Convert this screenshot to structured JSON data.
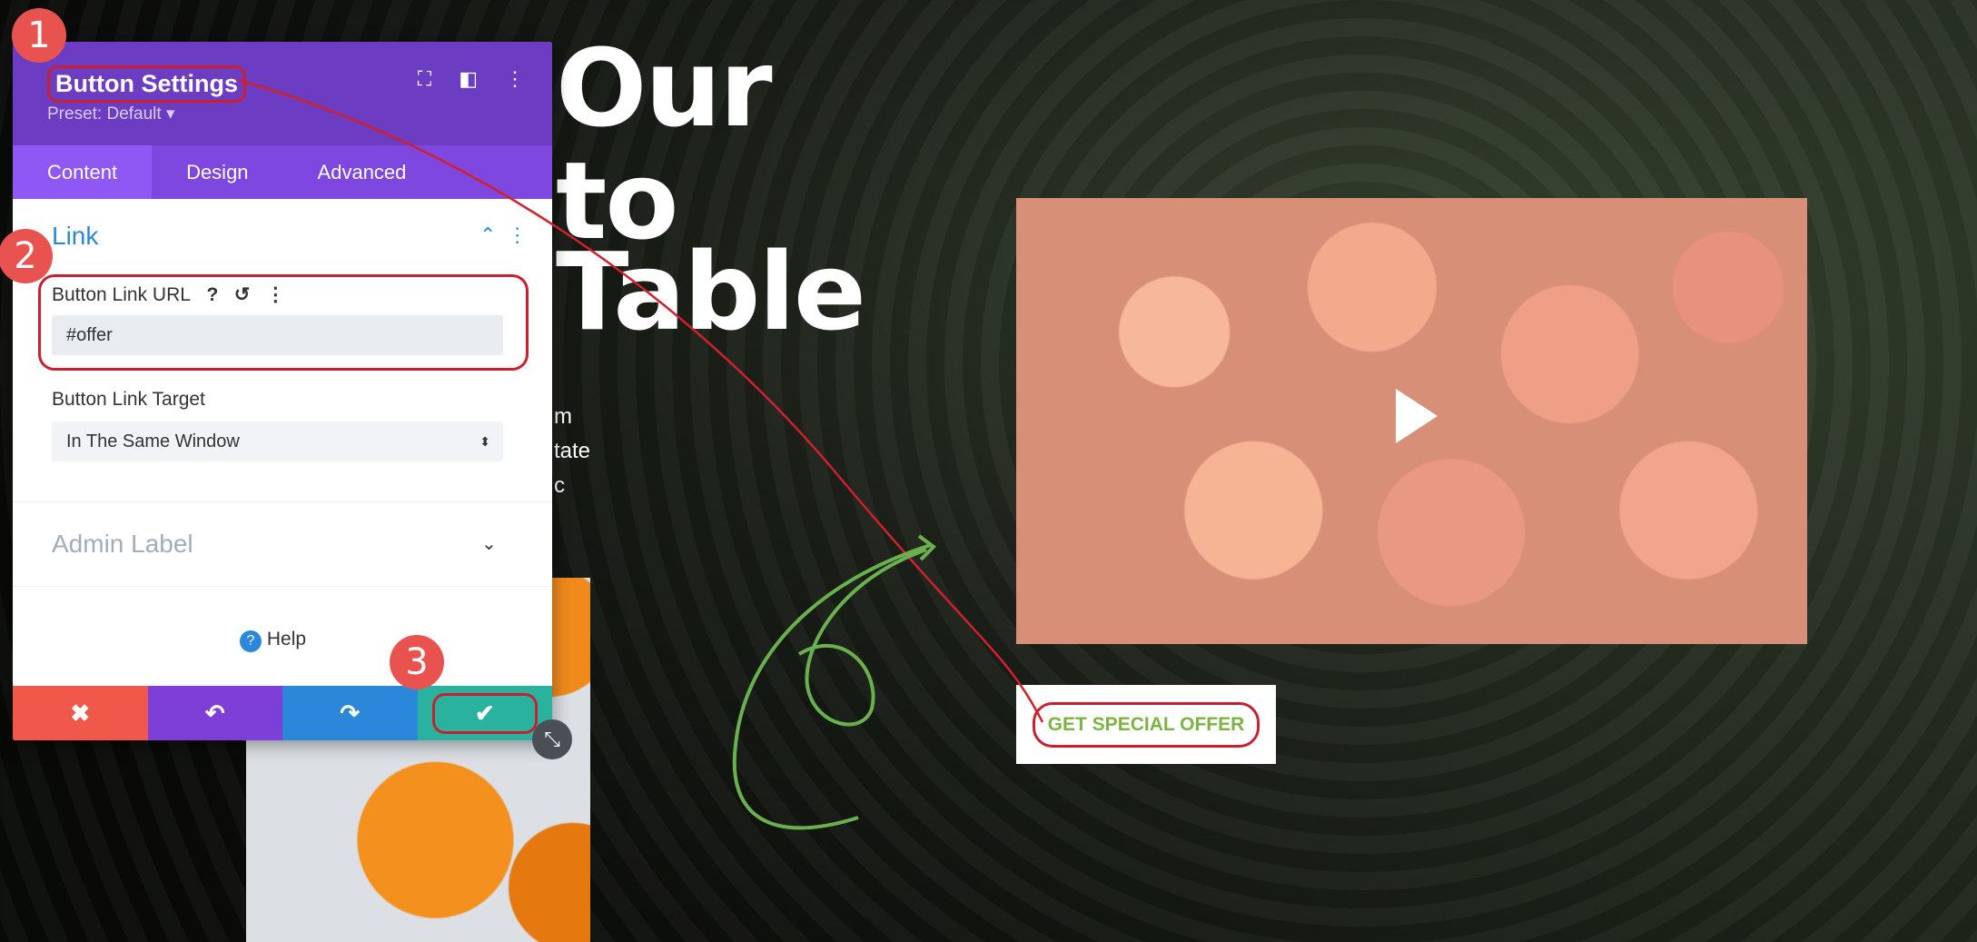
{
  "page": {
    "hero_lines": [
      "Our",
      "to",
      "Table"
    ],
    "partial_text": [
      "m",
      "tate",
      "c"
    ],
    "cta_label": "GET SPECIAL OFFER"
  },
  "panel": {
    "title": "Button Settings",
    "preset": "Preset: Default ▾",
    "header_icons": [
      "focus-icon",
      "split-view-icon",
      "more-icon"
    ],
    "tabs": [
      {
        "label": "Content",
        "active": true
      },
      {
        "label": "Design",
        "active": false
      },
      {
        "label": "Advanced",
        "active": false
      }
    ],
    "section_title": "Link",
    "url_label": "Button Link URL",
    "url_value": "#offer",
    "target_label": "Button Link Target",
    "target_value": "In The Same Window",
    "admin_label": "Admin Label",
    "help": "Help",
    "footer": {
      "cancel": "✖",
      "undo": "↶",
      "redo": "↷",
      "save": "✔"
    }
  },
  "annotations": [
    "1",
    "2",
    "3"
  ],
  "colors": {
    "panel_header": "#6c3dc2",
    "tabs": "#7e48e0",
    "cancel": "#f0584a",
    "undo": "#7d3fd8",
    "redo": "#2b87da",
    "save": "#29b39f",
    "annotation": "#c8202f",
    "cta_text": "#7cb342"
  }
}
